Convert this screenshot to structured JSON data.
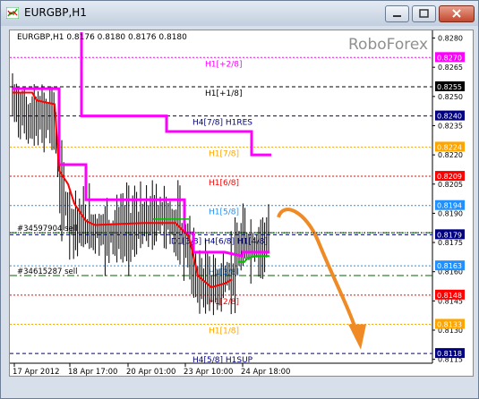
{
  "window": {
    "title": "EURGBP,H1"
  },
  "chart_header": "EURGBP,H1  0.8176 0.8180 0.8176 0.8180",
  "watermark": "RoboForex",
  "colors": {
    "magenta": "#ff00ff",
    "red": "#ff0000",
    "orange": "#ffa500",
    "navy": "#000080",
    "green": "#00c000",
    "teal": "#1e90ff"
  },
  "chart_data": {
    "type": "line",
    "ylim": [
      0.8113,
      0.8283
    ],
    "y_ticks": [
      "0.8280",
      "0.8265",
      "0.8250",
      "0.8235",
      "0.8220",
      "0.8205",
      "0.8190",
      "0.8175",
      "0.8160",
      "0.8145",
      "0.8130",
      "0.8115"
    ],
    "x_ticks": [
      "17 Apr 2012",
      "18 Apr 17:00",
      "20 Apr 01:00",
      "23 Apr 10:00",
      "24 Apr 18:00"
    ],
    "levels": [
      {
        "label": "H1[+2/8]",
        "value": 0.827,
        "price": "0.8270",
        "color": "#ff00ff"
      },
      {
        "label": "H1[+1/8]",
        "value": 0.8255,
        "price": "0.8255",
        "color": "#000000"
      },
      {
        "label": "H4[7/8] H1RES",
        "value": 0.824,
        "price": "0.8240",
        "color": "#000080"
      },
      {
        "label": "H1[7/8]",
        "value": 0.8224,
        "price": "0.8224",
        "color": "#ffa500"
      },
      {
        "label": "H1[6/8]",
        "value": 0.8209,
        "price": "0.8209",
        "color": "#ff0000"
      },
      {
        "label": "H1[5/8]",
        "value": 0.8194,
        "price": "0.8194",
        "color": "#1e90ff"
      },
      {
        "label": "D1[3/8] H4[6/8] H1[4/8]",
        "value": 0.8179,
        "price": "0.8179",
        "color": "#000080"
      },
      {
        "label": "H1[3/8]",
        "value": 0.8163,
        "price": "0.8163",
        "color": "#1e90ff"
      },
      {
        "label": "H1[2/8]",
        "value": 0.8148,
        "price": "0.8148",
        "color": "#ff0000"
      },
      {
        "label": "H1[1/8]",
        "value": 0.8133,
        "price": "0.8133",
        "color": "#ffa500"
      },
      {
        "label": "H4[5/8] H1SUP",
        "value": 0.8118,
        "price": "0.8118",
        "color": "#000080"
      }
    ],
    "orders": [
      {
        "label": "#34597904 sell",
        "value": 0.818
      },
      {
        "label": "#34615287 sell",
        "value": 0.8158
      }
    ],
    "current_price": "0.8180"
  }
}
